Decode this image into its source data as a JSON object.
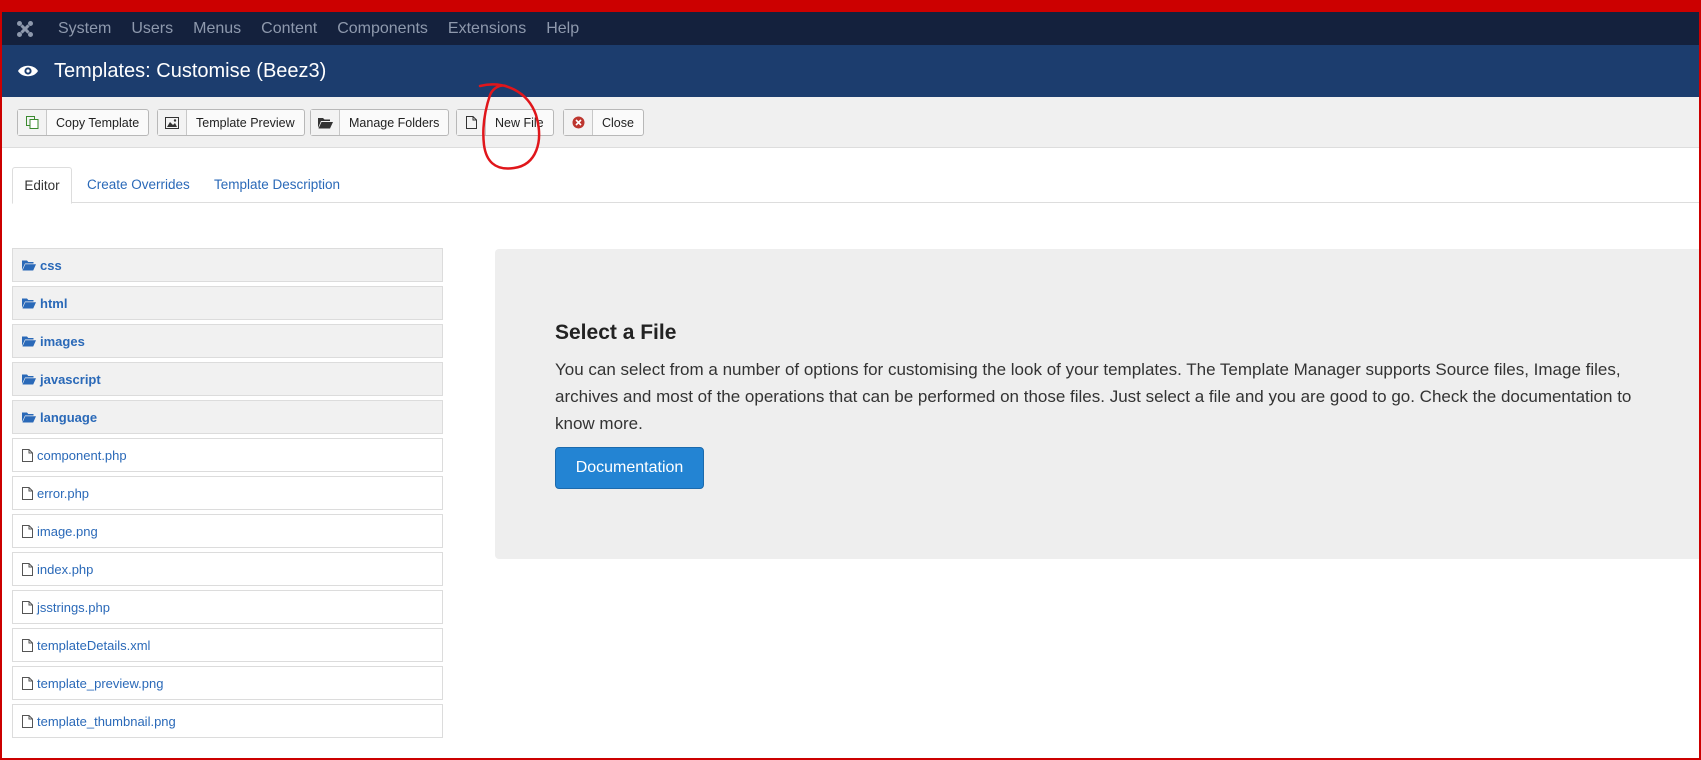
{
  "topnav": {
    "items": [
      "System",
      "Users",
      "Menus",
      "Content",
      "Components",
      "Extensions",
      "Help"
    ]
  },
  "header": {
    "title": "Templates: Customise (Beez3)"
  },
  "toolbar": {
    "copy_template": "Copy Template",
    "template_preview": "Template Preview",
    "manage_folders": "Manage Folders",
    "new_file": "New File",
    "close": "Close"
  },
  "tabs": {
    "editor": "Editor",
    "create_overrides": "Create Overrides",
    "template_description": "Template Description"
  },
  "tree": {
    "folders": [
      "css",
      "html",
      "images",
      "javascript",
      "language"
    ],
    "files": [
      "component.php",
      "error.php",
      "image.png",
      "index.php",
      "jsstrings.php",
      "templateDetails.xml",
      "template_preview.png",
      "template_thumbnail.png"
    ]
  },
  "panel": {
    "heading": "Select a File",
    "desc_line1": "You can select from a number of options for customising the look of your templates. The Template Manager supports Source files, Image files,",
    "desc_line2": "archives and most of the operations that can be performed on those files. Just select a file and you are good to go. Check the documentation to",
    "desc_line3": "know more.",
    "button": "Documentation"
  },
  "colors": {
    "topnav_bg": "#14213d",
    "header_bg": "#1c3d6e",
    "link": "#2a69b8",
    "primary_button": "#2384d3",
    "annotation": "#e0161b"
  }
}
